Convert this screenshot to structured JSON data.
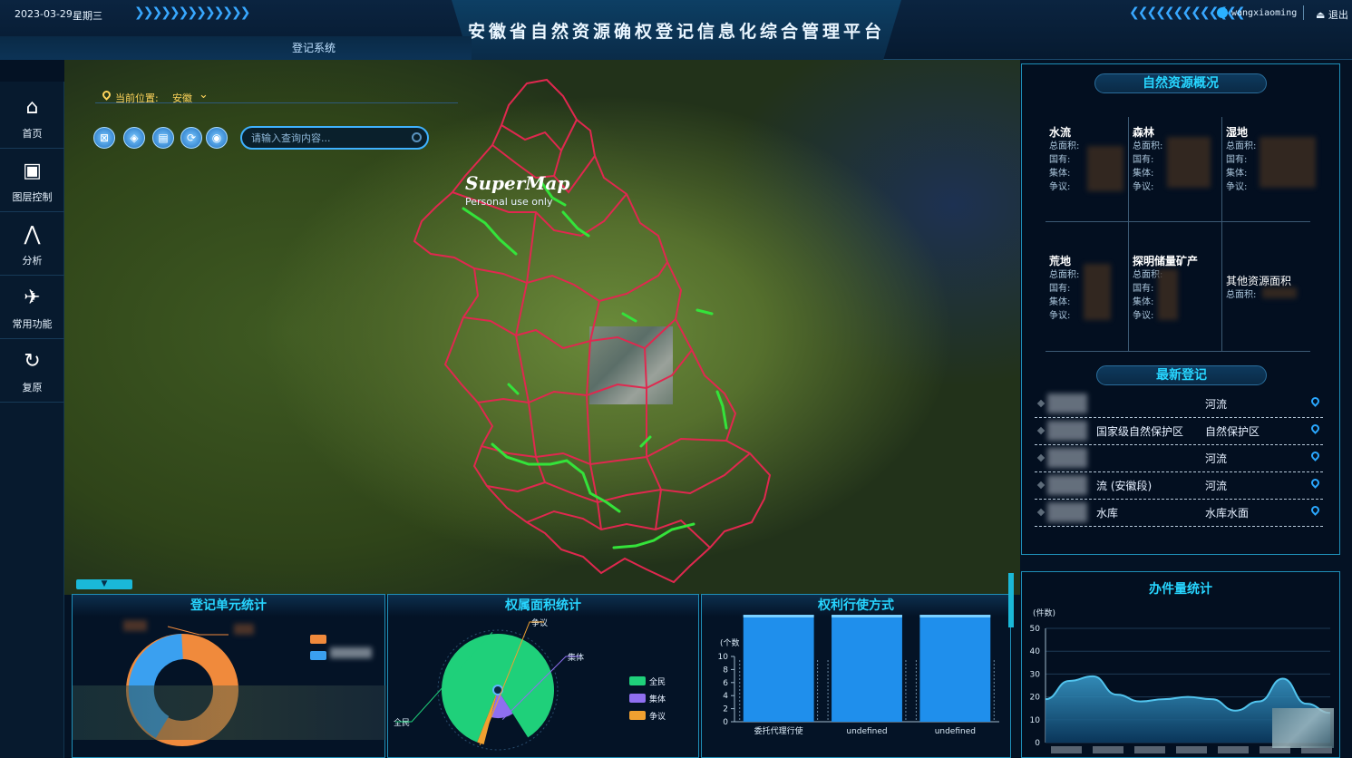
{
  "header": {
    "date": "2023-03-29",
    "weekday": "星期三",
    "title": "安徽省自然资源确权登记信息化综合管理平台",
    "tab": "登记系统",
    "username": "wangxiaoming",
    "logout": "退出"
  },
  "nav": [
    {
      "label": "首页",
      "icon": "home-icon"
    },
    {
      "label": "图层控制",
      "icon": "layers-icon"
    },
    {
      "label": "分析",
      "icon": "analysis-icon"
    },
    {
      "label": "常用功能",
      "icon": "tools-icon"
    },
    {
      "label": "复原",
      "icon": "reset-icon"
    }
  ],
  "map": {
    "location_label": "当前位置:",
    "location_value": "安徽",
    "search_placeholder": "请输入查询内容...",
    "watermark_title": "SuperMap",
    "watermark_sub": "Personal use only",
    "tools": [
      "clear-icon",
      "cube-icon",
      "layout-icon",
      "rotate-icon",
      "location-icon"
    ],
    "colors": {
      "boundary": "#e0284f",
      "river": "#34e33a"
    }
  },
  "resources": {
    "title": "自然资源概况",
    "field_labels": {
      "total": "总面积:",
      "state": "国有:",
      "collective": "集体:",
      "dispute": "争议:"
    },
    "items": [
      {
        "name": "水流"
      },
      {
        "name": "森林"
      },
      {
        "name": "湿地"
      },
      {
        "name": "荒地"
      },
      {
        "name": "探明储量矿产"
      },
      {
        "name": "其他资源面积"
      }
    ]
  },
  "latest": {
    "title": "最新登记",
    "rows": [
      {
        "name": "",
        "type": "河流"
      },
      {
        "name": "国家级自然保护区",
        "type": "自然保护区"
      },
      {
        "name": "",
        "type": "河流"
      },
      {
        "name": "流 (安徽段)",
        "type": "河流"
      },
      {
        "name": "水库",
        "type": "水库水面"
      }
    ]
  },
  "stats": {
    "unit_panel": {
      "title": "登记单元统计",
      "colors": [
        "#f08a3c",
        "#3aa0f0"
      ]
    },
    "area_panel": {
      "title": "权属面积统计",
      "legend": [
        {
          "label": "全民",
          "color": "#1fd07a"
        },
        {
          "label": "集体",
          "color": "#8f6ff0"
        },
        {
          "label": "争议",
          "color": "#f0a030"
        }
      ]
    },
    "rights_panel": {
      "title": "权利行使方式",
      "unit": "(个数"
    },
    "workload_panel": {
      "title": "办件量统计",
      "unit": "(件数)"
    }
  },
  "chart_data": [
    {
      "type": "pie",
      "title": "权属面积统计",
      "labels": [
        "全民",
        "集体",
        "争议"
      ],
      "values": [
        85,
        13,
        2
      ]
    },
    {
      "type": "bar",
      "title": "权利行使方式",
      "ylabel": "(个数",
      "categories": [
        "委托代理行使",
        "undefined",
        "undefined"
      ],
      "values": [
        10,
        10,
        10
      ],
      "ylim": [
        0,
        10
      ],
      "yticks": [
        0,
        2,
        4,
        6,
        8,
        10
      ]
    },
    {
      "type": "area",
      "title": "办件量统计",
      "ylabel": "(件数)",
      "x": [
        0,
        1,
        2,
        3,
        4,
        5,
        6,
        7,
        8,
        9,
        10,
        11,
        12
      ],
      "values": [
        19,
        27,
        29,
        21,
        18,
        19,
        20,
        19,
        14,
        18,
        28,
        17,
        13
      ],
      "ylim": [
        0,
        50
      ],
      "yticks": [
        0,
        10,
        20,
        30,
        40,
        50
      ]
    }
  ]
}
